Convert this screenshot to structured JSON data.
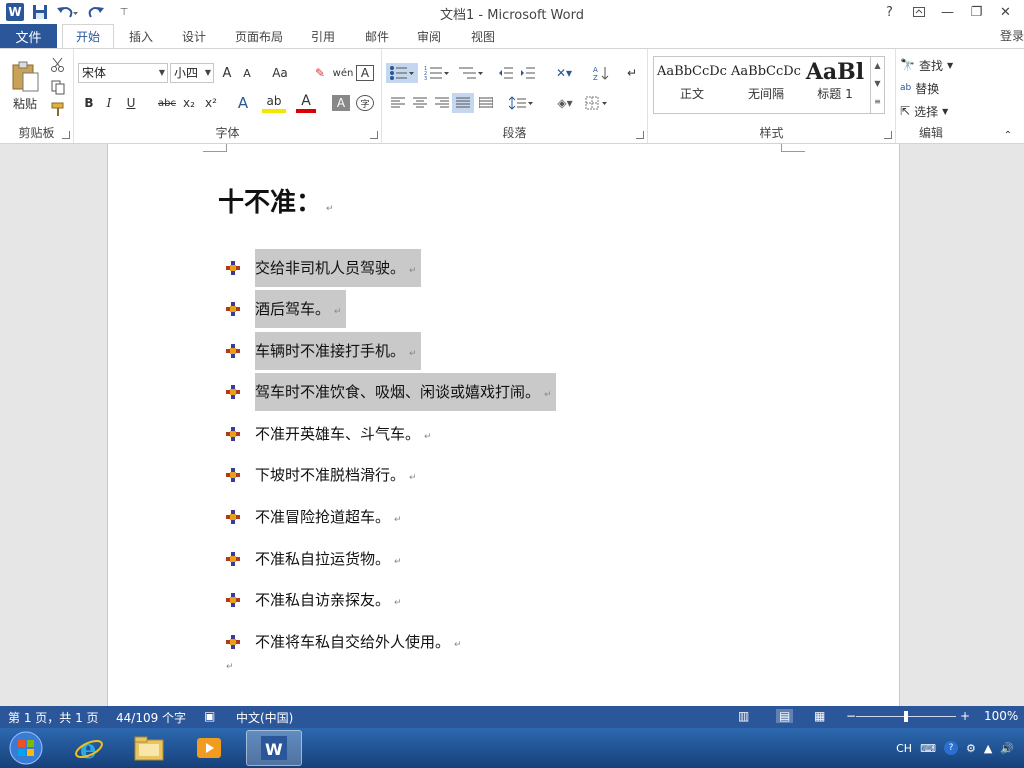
{
  "window": {
    "title": "文档1 - Microsoft Word",
    "help": "?",
    "ribbon_display": "⧉",
    "minimize": "—",
    "restore": "❐",
    "close": "✕"
  },
  "qat": {
    "save": "💾",
    "undo": "↶",
    "redo": "↷",
    "customize": "⌄"
  },
  "tabs": {
    "file": "文件",
    "home": "开始",
    "insert": "插入",
    "design": "设计",
    "layout": "页面布局",
    "references": "引用",
    "mailings": "邮件",
    "review": "审阅",
    "view": "视图",
    "login": "登录"
  },
  "ribbon": {
    "clipboard": {
      "label": "剪贴板",
      "paste": "粘贴"
    },
    "font": {
      "label": "字体",
      "font_name": "宋体",
      "font_size": "小四",
      "grow": "A",
      "shrink": "A",
      "case": "Aa",
      "bold": "B",
      "italic": "I",
      "underline": "U",
      "strike": "abc",
      "sub": "x₂",
      "sup": "x²",
      "effects": "A",
      "color": "A",
      "shade": "A",
      "enclose": "字",
      "phonetic": "wén",
      "border_char": "A"
    },
    "paragraph": {
      "label": "段落"
    },
    "styles": {
      "label": "样式",
      "items": [
        {
          "preview": "AaBbCcDc",
          "name": "正文"
        },
        {
          "preview": "AaBbCcDc",
          "name": "无间隔"
        },
        {
          "preview": "AaBl",
          "name": "标题 1"
        }
      ]
    },
    "editing": {
      "label": "编辑",
      "find": "查找",
      "replace": "替换",
      "select": "选择"
    }
  },
  "document": {
    "heading": "十不准：",
    "items": [
      {
        "text": "交给非司机人员驾驶。",
        "selected": true
      },
      {
        "text": "酒后驾车。",
        "selected": true
      },
      {
        "text": "车辆时不准接打手机。",
        "selected": true
      },
      {
        "text": "驾车时不准饮食、吸烟、闲谈或嬉戏打闹。",
        "selected": true
      },
      {
        "text": "不准开英雄车、斗气车。",
        "selected": false
      },
      {
        "text": "下坡时不准脱档滑行。",
        "selected": false
      },
      {
        "text": "不准冒险抢道超车。",
        "selected": false
      },
      {
        "text": "不准私自拉运货物。",
        "selected": false
      },
      {
        "text": "不准私自访亲探友。",
        "selected": false
      },
      {
        "text": "不准将车私自交给外人使用。",
        "selected": false
      }
    ],
    "para_mark": "↵"
  },
  "status": {
    "page": "第 1 页，共 1 页",
    "words": "44/109 个字",
    "language": "中文(中国)",
    "zoom": "100%",
    "zoom_level": 1.0
  },
  "taskbar": {
    "input_lang": "CH"
  }
}
